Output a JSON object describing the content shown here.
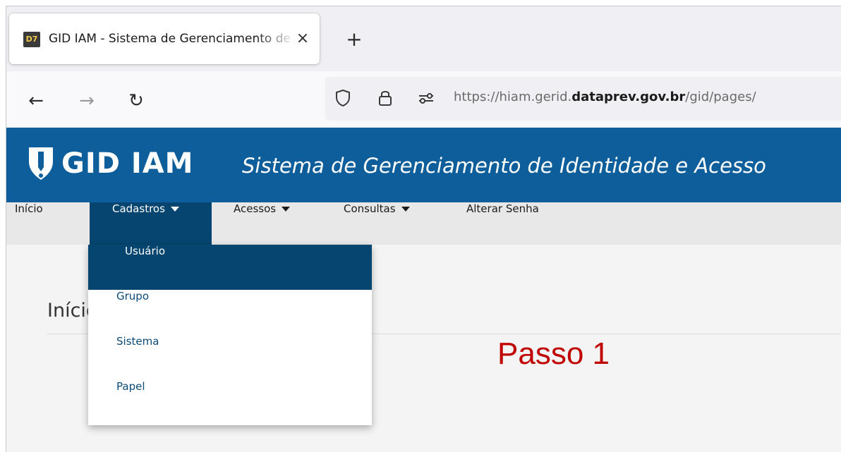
{
  "browser": {
    "tab": {
      "title": "GID IAM - Sistema de Gerenciamento de Identidade e Acesso",
      "favicon_text": "D7",
      "close": "×"
    },
    "new_tab": "+",
    "nav": {
      "back": "←",
      "forward": "→",
      "reload": "↻"
    },
    "url": {
      "prefix": "https://hiam.gerid.",
      "domain": "dataprev.gov.br",
      "path": "/gid/pages/"
    }
  },
  "header": {
    "logo": "GID IAM",
    "subtitle": "Sistema de Gerenciamento de Identidade e Acesso"
  },
  "menu": {
    "items": [
      {
        "label": "Início"
      },
      {
        "label": "Cadastros"
      },
      {
        "label": "Acessos"
      },
      {
        "label": "Consultas"
      },
      {
        "label": "Alterar Senha"
      }
    ],
    "dropdown": [
      {
        "label": "Usuário"
      },
      {
        "label": "Grupo"
      },
      {
        "label": "Sistema"
      },
      {
        "label": "Papel"
      }
    ]
  },
  "page": {
    "title": "Início"
  },
  "annotation": "Passo 1",
  "colors": {
    "header_bg": "#0d5e9a",
    "menu_active": "#06456f",
    "annotation": "#c00000",
    "dropdown_text": "#0a4a78"
  }
}
